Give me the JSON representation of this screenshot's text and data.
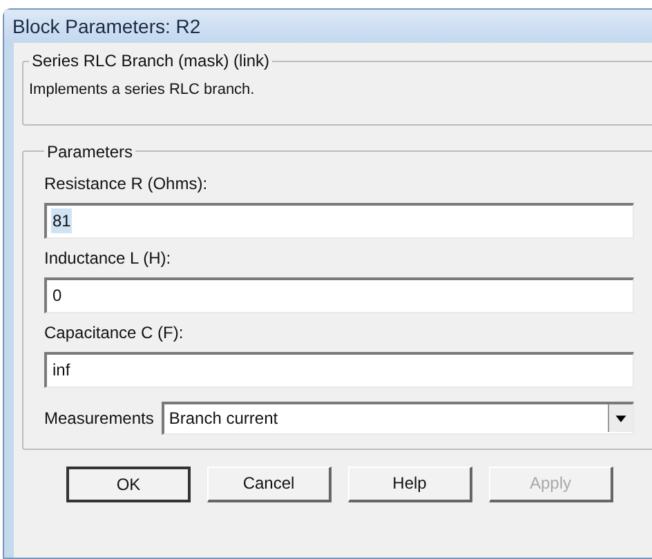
{
  "window": {
    "title": "Block Parameters: R2"
  },
  "description_group": {
    "title": "Series RLC Branch (mask) (link)",
    "text": "Implements a series RLC branch."
  },
  "parameters_group": {
    "title": "Parameters",
    "fields": [
      {
        "label": "Resistance R (Ohms):",
        "value": "81",
        "highlighted": true
      },
      {
        "label": "Inductance L (H):",
        "value": "0",
        "highlighted": false
      },
      {
        "label": "Capacitance C (F):",
        "value": "inf",
        "highlighted": false
      }
    ],
    "measurements": {
      "label": "Measurements",
      "value": "Branch current"
    }
  },
  "buttons": [
    {
      "label": "OK",
      "default": true,
      "disabled": false
    },
    {
      "label": "Cancel",
      "default": false,
      "disabled": false
    },
    {
      "label": "Help",
      "default": false,
      "disabled": false
    },
    {
      "label": "Apply",
      "default": false,
      "disabled": true
    }
  ]
}
